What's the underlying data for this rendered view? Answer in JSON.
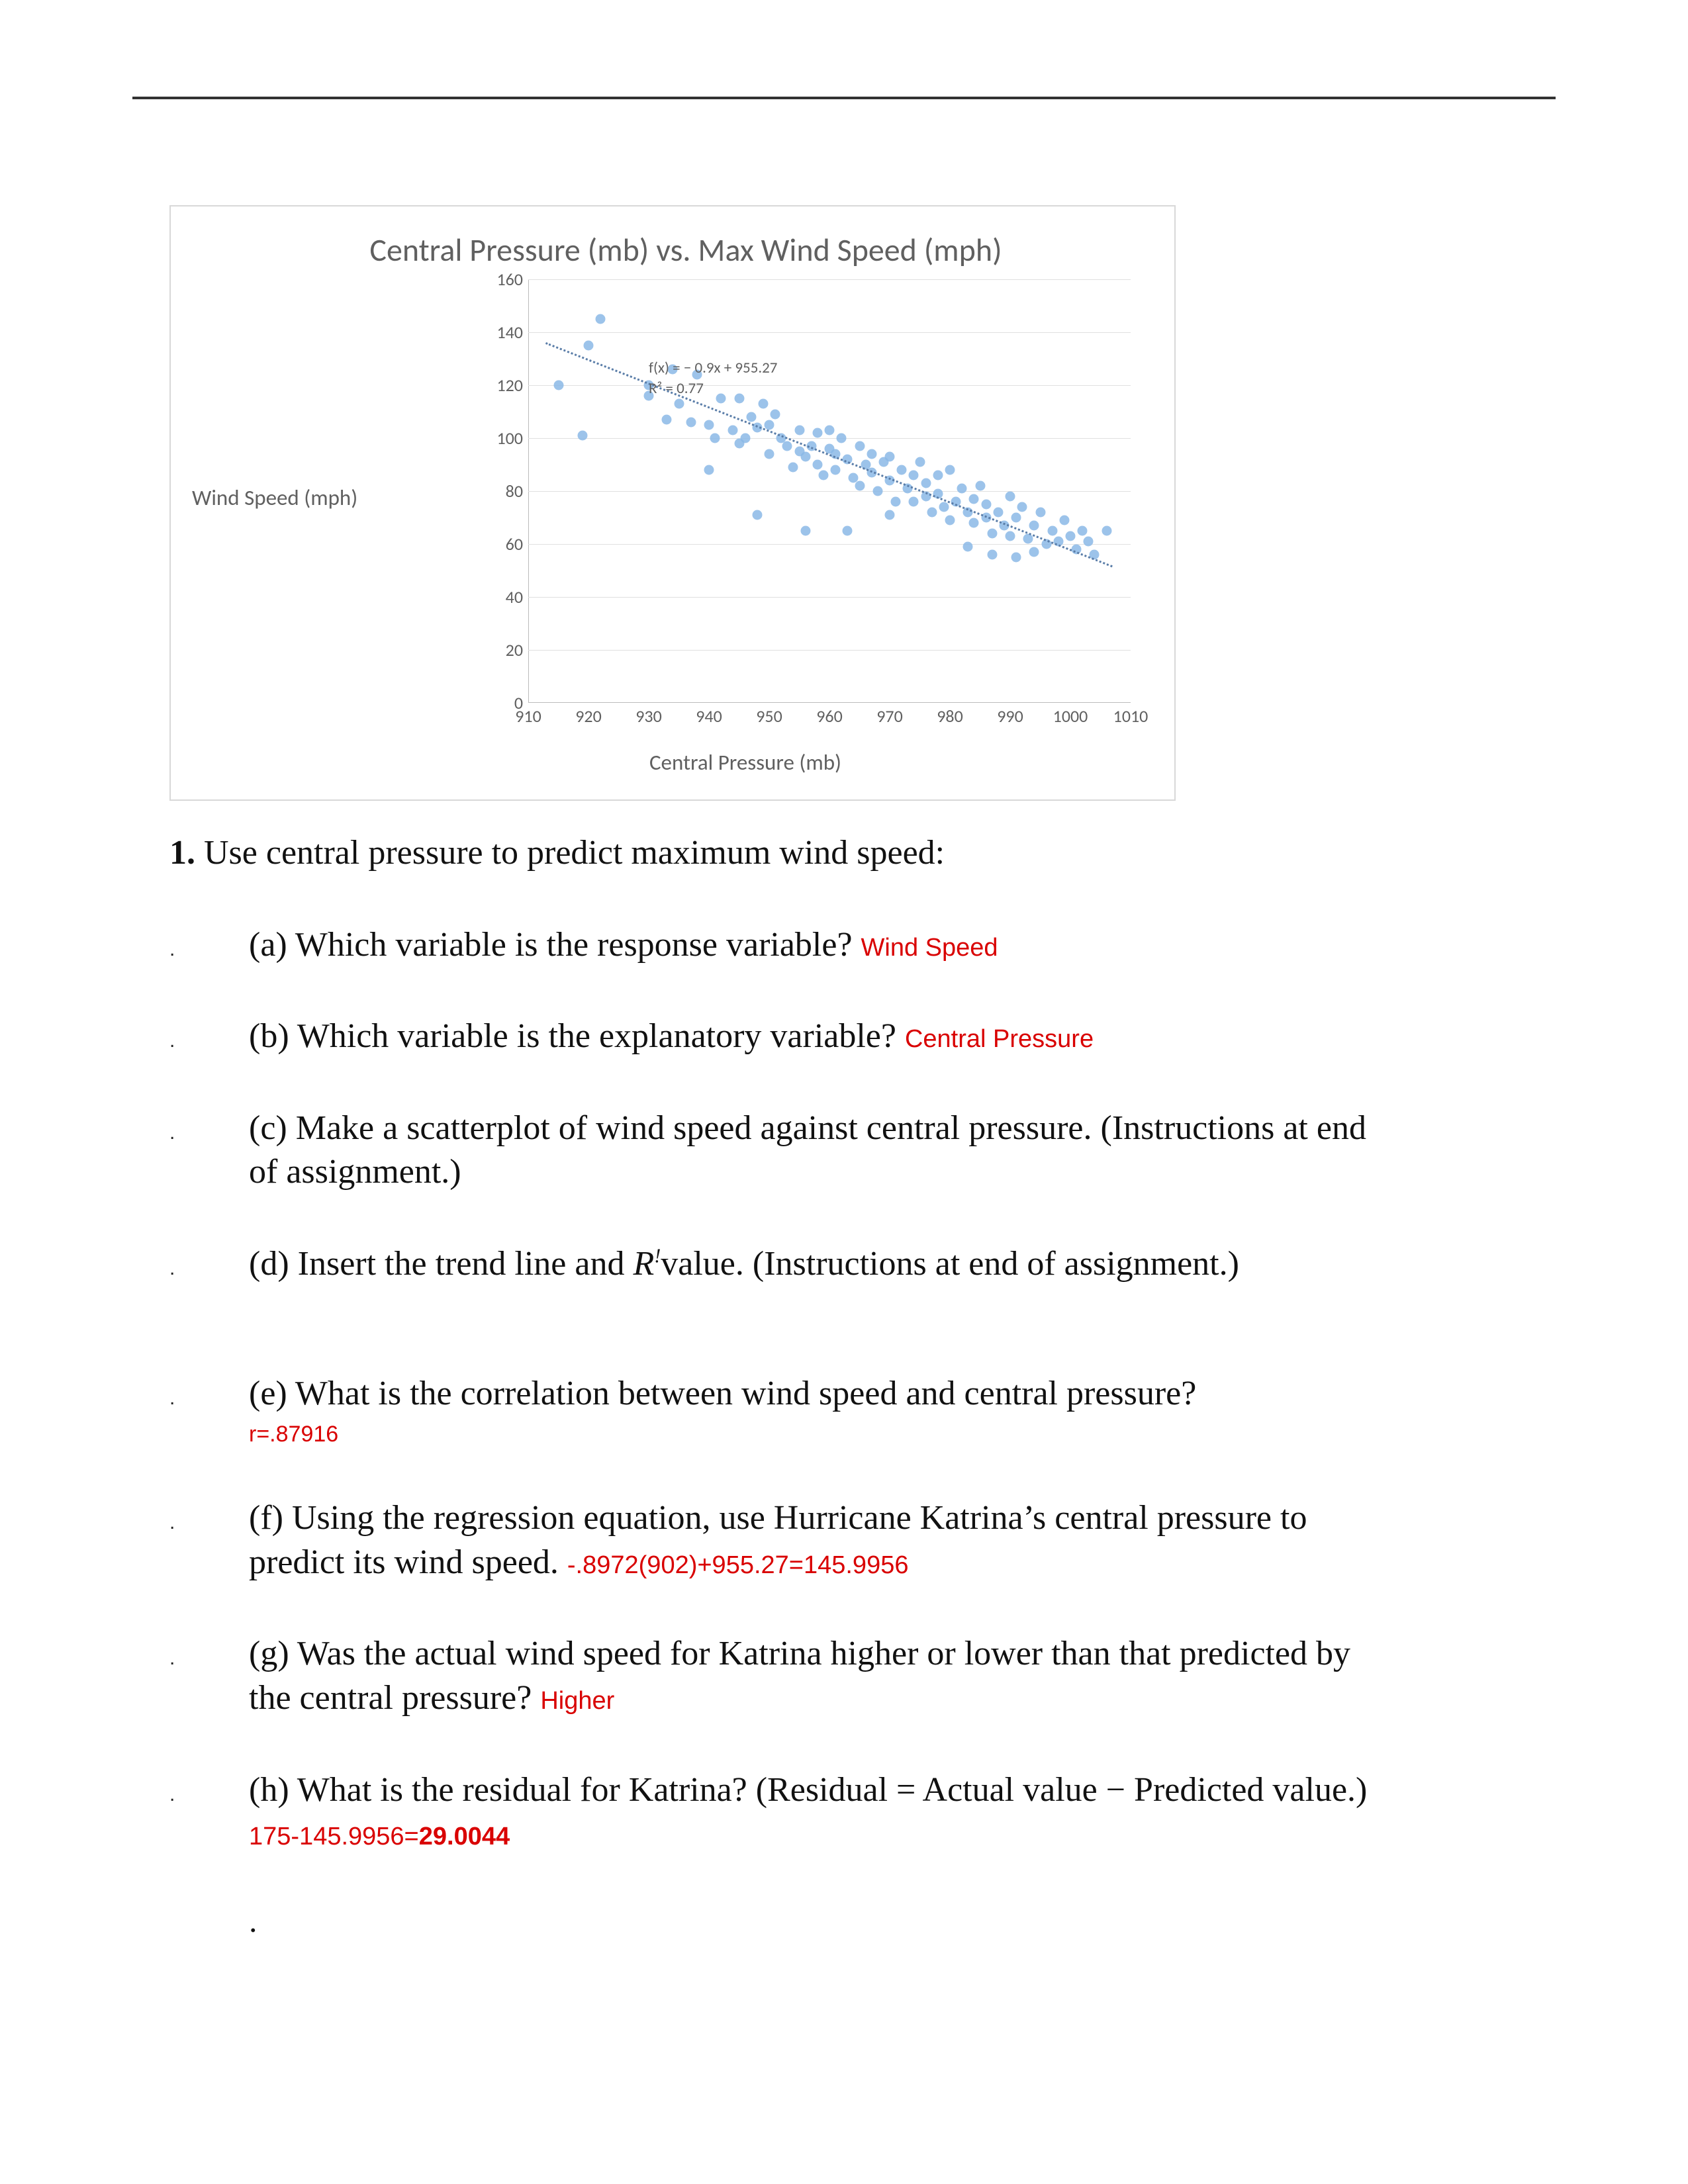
{
  "chart_data": {
    "type": "scatter",
    "title": "Central Pressure (mb) vs. Max Wind Speed (mph)",
    "xlabel": "Central Pressure (mb)",
    "ylabel": "Wind Speed (mph)",
    "xlim": [
      910,
      1010
    ],
    "ylim": [
      0,
      160
    ],
    "x_ticks": [
      910,
      920,
      930,
      940,
      950,
      960,
      970,
      980,
      990,
      1000,
      1010
    ],
    "y_ticks": [
      0,
      20,
      40,
      60,
      80,
      100,
      120,
      140,
      160
    ],
    "regression_label_line1": "f(x) = − 0.9x + 955.27",
    "regression_label_line2": "R² = 0.77",
    "regression": {
      "slope": -0.8972,
      "intercept": 955.27,
      "r2": 0.77
    },
    "points": [
      {
        "x": 915,
        "y": 120
      },
      {
        "x": 919,
        "y": 101
      },
      {
        "x": 920,
        "y": 135
      },
      {
        "x": 922,
        "y": 145
      },
      {
        "x": 930,
        "y": 116
      },
      {
        "x": 930,
        "y": 120
      },
      {
        "x": 933,
        "y": 107
      },
      {
        "x": 934,
        "y": 126
      },
      {
        "x": 935,
        "y": 113
      },
      {
        "x": 937,
        "y": 106
      },
      {
        "x": 938,
        "y": 124
      },
      {
        "x": 940,
        "y": 105
      },
      {
        "x": 940,
        "y": 88
      },
      {
        "x": 941,
        "y": 100
      },
      {
        "x": 942,
        "y": 115
      },
      {
        "x": 944,
        "y": 103
      },
      {
        "x": 945,
        "y": 115
      },
      {
        "x": 945,
        "y": 98
      },
      {
        "x": 946,
        "y": 100
      },
      {
        "x": 947,
        "y": 108
      },
      {
        "x": 948,
        "y": 71
      },
      {
        "x": 948,
        "y": 104
      },
      {
        "x": 949,
        "y": 113
      },
      {
        "x": 950,
        "y": 94
      },
      {
        "x": 950,
        "y": 105
      },
      {
        "x": 951,
        "y": 109
      },
      {
        "x": 952,
        "y": 100
      },
      {
        "x": 953,
        "y": 97
      },
      {
        "x": 954,
        "y": 89
      },
      {
        "x": 955,
        "y": 103
      },
      {
        "x": 955,
        "y": 95
      },
      {
        "x": 956,
        "y": 93
      },
      {
        "x": 956,
        "y": 65
      },
      {
        "x": 957,
        "y": 97
      },
      {
        "x": 958,
        "y": 102
      },
      {
        "x": 958,
        "y": 90
      },
      {
        "x": 959,
        "y": 86
      },
      {
        "x": 960,
        "y": 103
      },
      {
        "x": 960,
        "y": 96
      },
      {
        "x": 961,
        "y": 88
      },
      {
        "x": 961,
        "y": 94
      },
      {
        "x": 962,
        "y": 100
      },
      {
        "x": 963,
        "y": 92
      },
      {
        "x": 963,
        "y": 65
      },
      {
        "x": 964,
        "y": 85
      },
      {
        "x": 965,
        "y": 97
      },
      {
        "x": 965,
        "y": 82
      },
      {
        "x": 966,
        "y": 90
      },
      {
        "x": 967,
        "y": 87
      },
      {
        "x": 967,
        "y": 94
      },
      {
        "x": 968,
        "y": 80
      },
      {
        "x": 969,
        "y": 91
      },
      {
        "x": 970,
        "y": 84
      },
      {
        "x": 970,
        "y": 93
      },
      {
        "x": 970,
        "y": 71
      },
      {
        "x": 971,
        "y": 76
      },
      {
        "x": 972,
        "y": 88
      },
      {
        "x": 973,
        "y": 81
      },
      {
        "x": 974,
        "y": 86
      },
      {
        "x": 974,
        "y": 76
      },
      {
        "x": 975,
        "y": 91
      },
      {
        "x": 976,
        "y": 78
      },
      {
        "x": 976,
        "y": 83
      },
      {
        "x": 977,
        "y": 72
      },
      {
        "x": 978,
        "y": 86
      },
      {
        "x": 978,
        "y": 79
      },
      {
        "x": 979,
        "y": 74
      },
      {
        "x": 980,
        "y": 88
      },
      {
        "x": 980,
        "y": 69
      },
      {
        "x": 981,
        "y": 76
      },
      {
        "x": 982,
        "y": 81
      },
      {
        "x": 983,
        "y": 72
      },
      {
        "x": 983,
        "y": 59
      },
      {
        "x": 984,
        "y": 77
      },
      {
        "x": 984,
        "y": 68
      },
      {
        "x": 985,
        "y": 82
      },
      {
        "x": 986,
        "y": 70
      },
      {
        "x": 986,
        "y": 75
      },
      {
        "x": 987,
        "y": 64
      },
      {
        "x": 987,
        "y": 56
      },
      {
        "x": 988,
        "y": 72
      },
      {
        "x": 989,
        "y": 67
      },
      {
        "x": 990,
        "y": 78
      },
      {
        "x": 990,
        "y": 63
      },
      {
        "x": 991,
        "y": 70
      },
      {
        "x": 991,
        "y": 55
      },
      {
        "x": 992,
        "y": 74
      },
      {
        "x": 993,
        "y": 62
      },
      {
        "x": 994,
        "y": 67
      },
      {
        "x": 994,
        "y": 57
      },
      {
        "x": 995,
        "y": 72
      },
      {
        "x": 996,
        "y": 60
      },
      {
        "x": 997,
        "y": 65
      },
      {
        "x": 998,
        "y": 61
      },
      {
        "x": 999,
        "y": 69
      },
      {
        "x": 1000,
        "y": 63
      },
      {
        "x": 1001,
        "y": 58
      },
      {
        "x": 1002,
        "y": 65
      },
      {
        "x": 1003,
        "y": 61
      },
      {
        "x": 1004,
        "y": 56
      },
      {
        "x": 1006,
        "y": 65
      }
    ]
  },
  "questions": {
    "lead": {
      "number": "1.",
      "text": "Use central pressure to predict maximum wind speed:"
    },
    "items": [
      {
        "letter": "(a)",
        "text": "Which variable is the response variable?",
        "answer": "Wind Speed"
      },
      {
        "letter": "(b)",
        "text": "Which variable is the explanatory variable?",
        "answer": "Central Pressure"
      },
      {
        "letter": "(c)",
        "text": "Make a scatterplot of wind speed against central pressure. (Instructions at end of assignment.)"
      },
      {
        "letter": "(d)",
        "text_before_sup": "Insert the trend line and ",
        "r_label": "R",
        "sup": "!",
        "text_after_sup": "value. (Instructions at end of assignment.)"
      },
      {
        "letter": "(e)",
        "text": "What is the correlation between wind speed and central pressure?",
        "answer_below": "r=.87916"
      },
      {
        "letter": "(f)",
        "text": "Using the regression equation, use Hurricane Katrina’s central pressure to predict its wind speed.",
        "answer_inline_after": " -.8972(902)+955.27=145.9956"
      },
      {
        "letter": "(g)",
        "text": "Was the actual wind speed for Katrina higher or lower than that predicted by the central pressure?",
        "answer_inline_after": "Higher"
      },
      {
        "letter": "(h)",
        "text_part1": "What is the residual for Katrina? (Residual = Actual value − Predicted value.)",
        "answer_part1": "175-145.9956=",
        "answer_bold": "29.0044"
      }
    ]
  }
}
